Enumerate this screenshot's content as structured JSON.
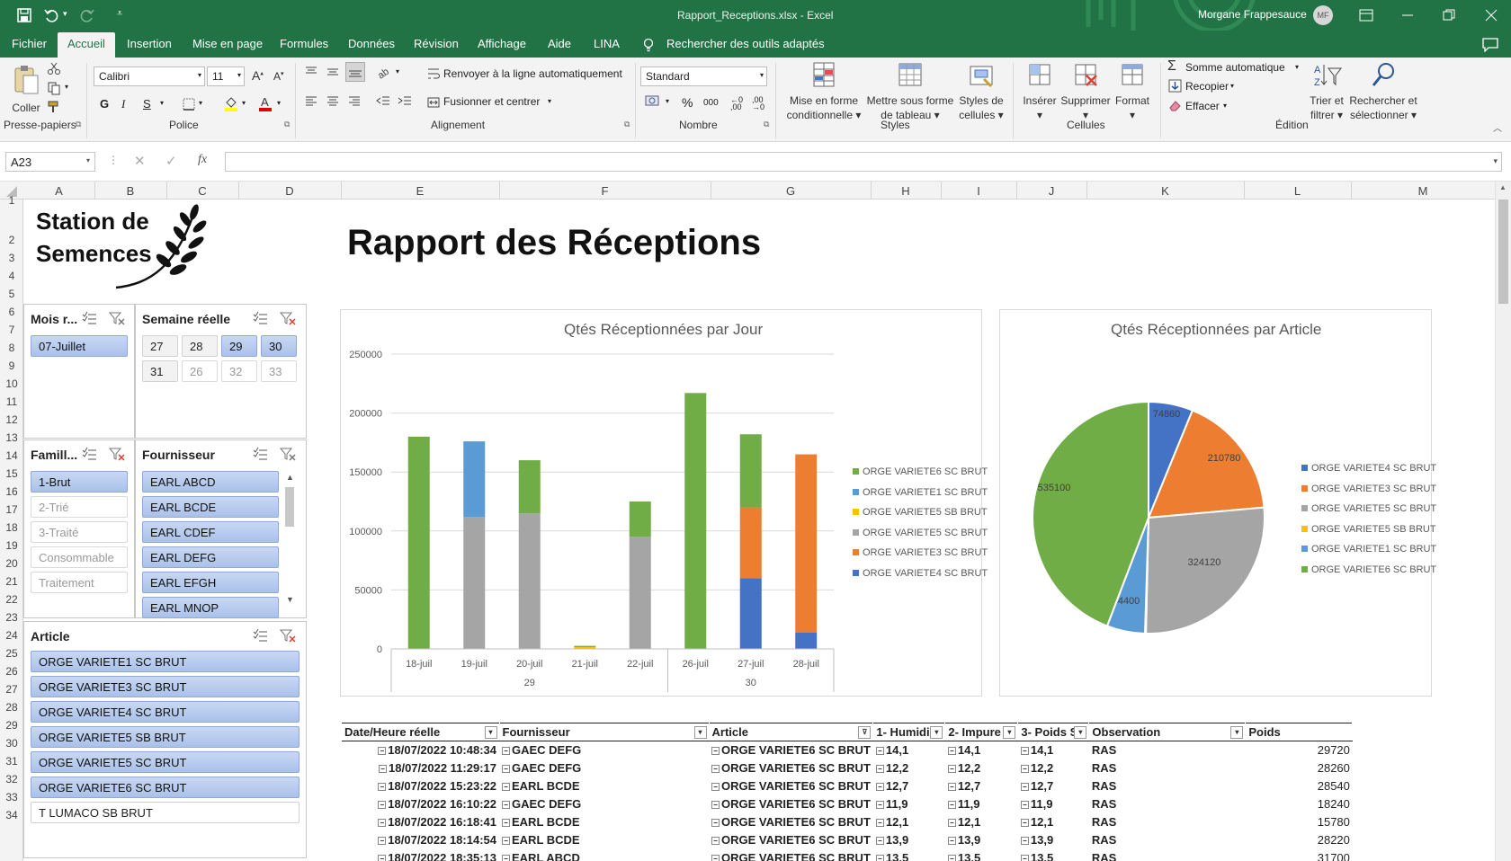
{
  "app": {
    "filename": "Rapport_Receptions.xlsx",
    "app_name": "Excel",
    "separator": "-",
    "user_name": "Morgane Frappesauce",
    "user_initials": "MF"
  },
  "menu": {
    "tabs": [
      "Fichier",
      "Accueil",
      "Insertion",
      "Mise en page",
      "Formules",
      "Données",
      "Révision",
      "Affichage",
      "Aide",
      "LINA"
    ],
    "active_tab": "Accueil",
    "search_label": "Rechercher des outils adaptés"
  },
  "ribbon": {
    "clipboard": {
      "paste": "Coller",
      "group": "Presse-papiers"
    },
    "font": {
      "name": "Calibri",
      "size": "11",
      "group": "Police",
      "bold": "G",
      "italic": "I",
      "underline": "S"
    },
    "alignment": {
      "wrap": "Renvoyer à la ligne automatiquement",
      "merge": "Fusionner et centrer",
      "group": "Alignement"
    },
    "number": {
      "format": "Standard",
      "percent": "%",
      "thousands": "000",
      "group": "Nombre"
    },
    "styles": {
      "conditional_1": "Mise en forme",
      "conditional_2": "conditionnelle",
      "table_1": "Mettre sous forme",
      "table_2": "de tableau",
      "cell_1": "Styles de",
      "cell_2": "cellules",
      "group": "Styles"
    },
    "cells": {
      "insert": "Insérer",
      "delete": "Supprimer",
      "format": "Format",
      "group": "Cellules"
    },
    "editing": {
      "autosum": "Somme automatique",
      "fill": "Recopier",
      "clear": "Effacer",
      "sort_1": "Trier et",
      "sort_2": "filtrer",
      "find_1": "Rechercher et",
      "find_2": "sélectionner",
      "group": "Édition"
    }
  },
  "formula_bar": {
    "name_box": "A23",
    "fx": "fx",
    "value": ""
  },
  "columns": [
    "A",
    "B",
    "C",
    "D",
    "E",
    "F",
    "G",
    "H",
    "I",
    "J",
    "K",
    "L",
    "M"
  ],
  "rows": [
    "1",
    "2",
    "3",
    "4",
    "5",
    "6",
    "7",
    "8",
    "9",
    "10",
    "11",
    "12",
    "13",
    "14",
    "15",
    "16",
    "17",
    "18",
    "19",
    "20",
    "21",
    "22",
    "23",
    "24",
    "25",
    "26",
    "27",
    "28",
    "29",
    "30",
    "31",
    "32",
    "33",
    "34"
  ],
  "logo": {
    "line1": "Station de",
    "line2": "Semences"
  },
  "report_title": "Rapport des Réceptions",
  "slicers": {
    "mois": {
      "title": "Mois r...",
      "items": [
        {
          "label": "07-Juillet",
          "state": "sel"
        }
      ]
    },
    "semaine": {
      "title": "Semaine réelle",
      "items": [
        {
          "label": "27",
          "state": "half"
        },
        {
          "label": "28",
          "state": "half"
        },
        {
          "label": "29",
          "state": "sel"
        },
        {
          "label": "30",
          "state": "sel"
        },
        {
          "label": "31",
          "state": "half"
        },
        {
          "label": "26",
          "state": "un"
        },
        {
          "label": "32",
          "state": "un"
        },
        {
          "label": "33",
          "state": "un"
        }
      ]
    },
    "famille": {
      "title": "Famill...",
      "items": [
        {
          "label": "1-Brut",
          "state": "sel"
        },
        {
          "label": "2-Trié",
          "state": "un"
        },
        {
          "label": "3-Traité",
          "state": "un"
        },
        {
          "label": "Consommable",
          "state": "un"
        },
        {
          "label": "Traitement",
          "state": "un"
        }
      ]
    },
    "fournisseur": {
      "title": "Fournisseur",
      "items": [
        {
          "label": "EARL ABCD",
          "state": "sel"
        },
        {
          "label": "EARL BCDE",
          "state": "sel"
        },
        {
          "label": "EARL CDEF",
          "state": "sel"
        },
        {
          "label": "EARL DEFG",
          "state": "sel"
        },
        {
          "label": "EARL EFGH",
          "state": "sel"
        },
        {
          "label": "EARL MNOP",
          "state": "sel"
        }
      ]
    },
    "article": {
      "title": "Article",
      "items": [
        {
          "label": "ORGE VARIETE1 SC BRUT",
          "state": "sel"
        },
        {
          "label": "ORGE VARIETE3 SC BRUT",
          "state": "sel"
        },
        {
          "label": "ORGE VARIETE4 SC BRUT",
          "state": "sel"
        },
        {
          "label": "ORGE VARIETE5 SB BRUT",
          "state": "sel"
        },
        {
          "label": "ORGE VARIETE5 SC BRUT",
          "state": "sel"
        },
        {
          "label": "ORGE VARIETE6 SC BRUT",
          "state": "sel"
        },
        {
          "label": "T LUMACO SB BRUT",
          "state": "unsel"
        }
      ]
    }
  },
  "chart_data": [
    {
      "type": "bar",
      "stacked": true,
      "title": "Qtés Réceptionnées par Jour",
      "categories": [
        "18-juil",
        "19-juil",
        "20-juil",
        "21-juil",
        "22-juil",
        "26-juil",
        "27-juil",
        "28-juil"
      ],
      "groups": [
        {
          "label": "29",
          "span": 5
        },
        {
          "label": "30",
          "span": 3
        }
      ],
      "ylim": [
        0,
        250000
      ],
      "yticks": [
        "0",
        "50000",
        "100000",
        "150000",
        "200000",
        "250000"
      ],
      "legend_position": "right",
      "series": [
        {
          "name": "ORGE VARIETE4 SC BRUT",
          "color": "#4472c4",
          "values": [
            0,
            0,
            0,
            0,
            0,
            0,
            60000,
            14000
          ]
        },
        {
          "name": "ORGE VARIETE3 SC BRUT",
          "color": "#ed7d31",
          "values": [
            0,
            0,
            0,
            0,
            0,
            0,
            60000,
            151000
          ]
        },
        {
          "name": "ORGE VARIETE5 SC BRUT",
          "color": "#a5a5a5",
          "values": [
            0,
            112000,
            115000,
            0,
            95000,
            0,
            0,
            0
          ]
        },
        {
          "name": "ORGE VARIETE5 SB BRUT",
          "color": "#ffc000",
          "values": [
            0,
            0,
            0,
            1560,
            0,
            0,
            0,
            0
          ]
        },
        {
          "name": "ORGE VARIETE1 SC BRUT",
          "color": "#5b9bd5",
          "values": [
            0,
            64000,
            0,
            0,
            0,
            0,
            0,
            0
          ]
        },
        {
          "name": "ORGE VARIETE6 SC BRUT",
          "color": "#70ad47",
          "values": [
            180000,
            0,
            45000,
            1000,
            30000,
            217000,
            62000,
            0
          ]
        }
      ]
    },
    {
      "type": "pie",
      "title": "Qtés Réceptionnées par Article",
      "legend_position": "right",
      "slices": [
        {
          "name": "ORGE VARIETE4 SC BRUT",
          "color": "#4472c4",
          "value": 74860
        },
        {
          "name": "ORGE VARIETE3 SC BRUT",
          "color": "#ed7d31",
          "value": 210780
        },
        {
          "name": "ORGE VARIETE5 SC BRUT",
          "color": "#a5a5a5",
          "value": 324120
        },
        {
          "name": "ORGE VARIETE5 SB BRUT",
          "color": "#ffc000",
          "value": 1560
        },
        {
          "name": "ORGE VARIETE1 SC BRUT",
          "color": "#5b9bd5",
          "value": 64400
        },
        {
          "name": "ORGE VARIETE6 SC BRUT",
          "color": "#70ad47",
          "value": 535100
        }
      ]
    }
  ],
  "pivot": {
    "headers": [
      "Date/Heure réelle",
      "Fournisseur",
      "Article",
      "1- Humidi",
      "2- Impure",
      "3- Poids S",
      "Observation",
      "Poids"
    ],
    "rows": [
      [
        "18/07/2022 10:48:34",
        "GAEC DEFG",
        "ORGE VARIETE6 SC BRUT",
        "14,1",
        "14,1",
        "14,1",
        "RAS",
        "29720"
      ],
      [
        "18/07/2022 11:29:17",
        "GAEC DEFG",
        "ORGE VARIETE6 SC BRUT",
        "12,2",
        "12,2",
        "12,2",
        "RAS",
        "28260"
      ],
      [
        "18/07/2022 15:23:22",
        "EARL BCDE",
        "ORGE VARIETE6 SC BRUT",
        "12,7",
        "12,7",
        "12,7",
        "RAS",
        "28540"
      ],
      [
        "18/07/2022 16:10:22",
        "GAEC DEFG",
        "ORGE VARIETE6 SC BRUT",
        "11,9",
        "11,9",
        "11,9",
        "RAS",
        "18240"
      ],
      [
        "18/07/2022 16:18:41",
        "EARL BCDE",
        "ORGE VARIETE6 SC BRUT",
        "12,1",
        "12,1",
        "12,1",
        "RAS",
        "15780"
      ],
      [
        "18/07/2022 18:14:54",
        "EARL BCDE",
        "ORGE VARIETE6 SC BRUT",
        "13,9",
        "13,9",
        "13,9",
        "RAS",
        "28220"
      ],
      [
        "18/07/2022 18:35:13",
        "EARL ABCD",
        "ORGE VARIETE6 SC BRUT",
        "13,5",
        "13,5",
        "13,5",
        "RAS",
        "31700"
      ]
    ]
  }
}
